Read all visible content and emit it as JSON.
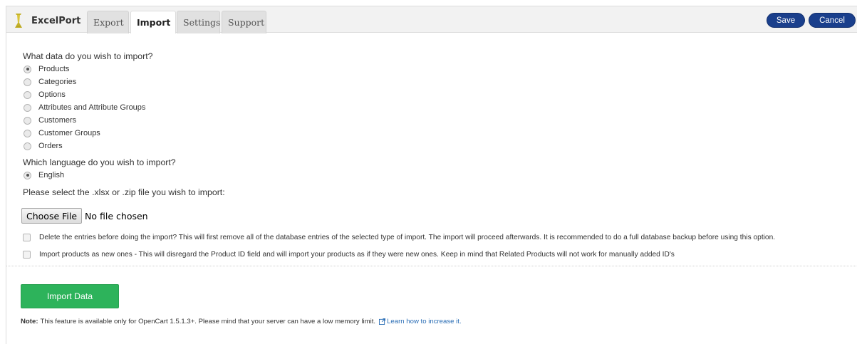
{
  "app": {
    "name": "ExcelPort"
  },
  "tabs": [
    {
      "label": "Export",
      "active": false
    },
    {
      "label": "Import",
      "active": true
    },
    {
      "label": "Settings",
      "active": false
    },
    {
      "label": "Support",
      "active": false
    }
  ],
  "actions": {
    "save": "Save",
    "cancel": "Cancel"
  },
  "import": {
    "data_question": "What data do you wish to import?",
    "data_options": [
      "Products",
      "Categories",
      "Options",
      "Attributes and Attribute Groups",
      "Customers",
      "Customer Groups",
      "Orders"
    ],
    "data_selected": "Products",
    "language_question": "Which language do you wish to import?",
    "language_options": [
      "English"
    ],
    "language_selected": "English",
    "file_question": "Please select the .xlsx or .zip file you wish to import:",
    "file_button": "Choose File",
    "file_status": "No file chosen",
    "option_delete": "Delete the entries before doing the import? This will first remove all of the database entries of the selected type of import. The import will proceed afterwards. It is recommended to do a full database backup before using this option.",
    "option_delete_checked": false,
    "option_new": "Import products as new ones - This will disregard the Product ID field and will import your products as if they were new ones. Keep in mind that Related Products will not work for manually added ID's",
    "option_new_checked": false,
    "import_button": "Import Data",
    "note_label": "Note:",
    "note_text": "This feature is available only for OpenCart 1.5.1.3+. Please mind that your server can have a low memory limit.",
    "note_link": "Learn how to increase it."
  },
  "colors": {
    "primary_button": "#1a3f8c",
    "import_button": "#2db35b",
    "link": "#2a6db5",
    "header_bg": "#f2f2f2"
  },
  "icons": {
    "brand": "excelport-logo-icon",
    "external_link": "external-link-icon"
  }
}
